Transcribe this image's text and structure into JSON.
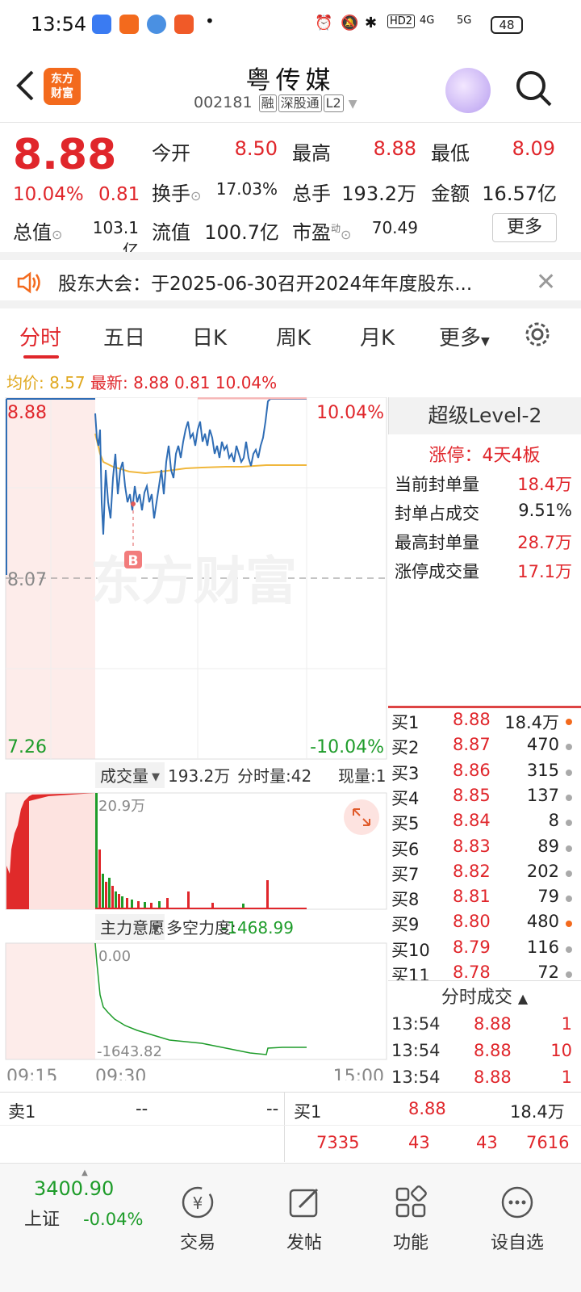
{
  "status_bar": {
    "time": "13:54",
    "battery": "48",
    "signal_a": "4G",
    "signal_b": "5G",
    "hd": "HD2"
  },
  "header": {
    "title": "粤传媒",
    "code": "002181",
    "tags": [
      "融",
      "深股通",
      "L2"
    ],
    "logo_text": "东方\n财富"
  },
  "quote": {
    "price": "8.88",
    "change_pct": "10.04%",
    "change": "0.81",
    "open_label": "今开",
    "open": "8.50",
    "high_label": "最高",
    "high": "8.88",
    "low_label": "最低",
    "low": "8.09",
    "turnover_label": "换手",
    "turnover": "17.03%",
    "volume_label": "总手",
    "volume": "193.2万",
    "amount_label": "金额",
    "amount": "16.57亿",
    "mktcap_label": "总值",
    "mktcap": "103.1亿",
    "float_label": "流值",
    "float_cap": "100.7亿",
    "pe_label": "市盈",
    "pe_sup": "动",
    "pe": "70.49",
    "more_label": "更多"
  },
  "notice": {
    "text": "股东大会：于2025-06-30召开2024年年度股东..."
  },
  "tabs": [
    "分时",
    "五日",
    "日K",
    "周K",
    "月K",
    "更多"
  ],
  "avg_line": {
    "avg_label": "均价:",
    "avg": "8.57",
    "latest_label": "最新:",
    "latest": "8.88",
    "chg": "0.81",
    "pct": "10.04%"
  },
  "chart_data": {
    "type": "line",
    "price_axis": {
      "top": "8.88",
      "mid": "8.07",
      "bottom": "7.26",
      "top_pct": "10.04%",
      "bottom_pct": "-10.04%"
    },
    "marker": "B",
    "watermark": "东方财富",
    "volume_panel": {
      "label": "成交量",
      "total": "193.2万",
      "per_min_label": "分时量:42",
      "now_label": "现量:1",
      "max": "20.9万"
    },
    "flow_panel": {
      "label": "主力意愿",
      "force_label": "多空力度:",
      "force": "-1468.99",
      "top": "0.00",
      "bottom": "-1643.82"
    },
    "time_axis": [
      "09:15",
      "09:30",
      "15:00"
    ]
  },
  "level2": {
    "title": "超级Level-2",
    "limit_up": "涨停：4天4板",
    "rows": [
      {
        "label": "当前封单量",
        "value": "18.4万"
      },
      {
        "label": "封单占成交",
        "value": "9.51%"
      },
      {
        "label": "最高封单量",
        "value": "28.7万"
      },
      {
        "label": "涨停成交量",
        "value": "17.1万"
      }
    ]
  },
  "bids": [
    {
      "name": "买1",
      "price": "8.88",
      "qty": "18.4万",
      "dot": "#f36a1d"
    },
    {
      "name": "买2",
      "price": "8.87",
      "qty": "470",
      "dot": "#aaaaaa"
    },
    {
      "name": "买3",
      "price": "8.86",
      "qty": "315",
      "dot": "#aaaaaa"
    },
    {
      "name": "买4",
      "price": "8.85",
      "qty": "137",
      "dot": "#aaaaaa"
    },
    {
      "name": "买5",
      "price": "8.84",
      "qty": "8",
      "dot": "#aaaaaa"
    },
    {
      "name": "买6",
      "price": "8.83",
      "qty": "89",
      "dot": "#aaaaaa"
    },
    {
      "name": "买7",
      "price": "8.82",
      "qty": "202",
      "dot": "#aaaaaa"
    },
    {
      "name": "买8",
      "price": "8.81",
      "qty": "79",
      "dot": "#aaaaaa"
    },
    {
      "name": "买9",
      "price": "8.80",
      "qty": "480",
      "dot": "#f36a1d"
    },
    {
      "name": "买10",
      "price": "8.79",
      "qty": "116",
      "dot": "#aaaaaa"
    },
    {
      "name": "买11",
      "price": "8.78",
      "qty": "72",
      "dot": "#aaaaaa"
    }
  ],
  "ticks": {
    "title": "分时成交",
    "rows": [
      {
        "time": "13:54",
        "price": "8.88",
        "vol": "1"
      },
      {
        "time": "13:54",
        "price": "8.88",
        "vol": "10"
      },
      {
        "time": "13:54",
        "price": "8.88",
        "vol": "1"
      }
    ]
  },
  "strip": {
    "sell1_label": "卖1",
    "sell1_price": "--",
    "sell1_qty": "--",
    "buy1_label": "买1",
    "buy1_price": "8.88",
    "buy1_qty": "18.4万",
    "r2": [
      "7335",
      "43",
      "43",
      "7616"
    ]
  },
  "nav": {
    "index_value": "3400.90",
    "index_name": "上证",
    "index_chg": "-0.04%",
    "items": [
      "交易",
      "发帖",
      "功能",
      "设自选"
    ]
  },
  "colors": {
    "up": "#e0262b",
    "down": "#1e9c2a",
    "price_line": "#2f6db5",
    "avg_line": "#f0b73c",
    "brand": "#f36a1d"
  }
}
